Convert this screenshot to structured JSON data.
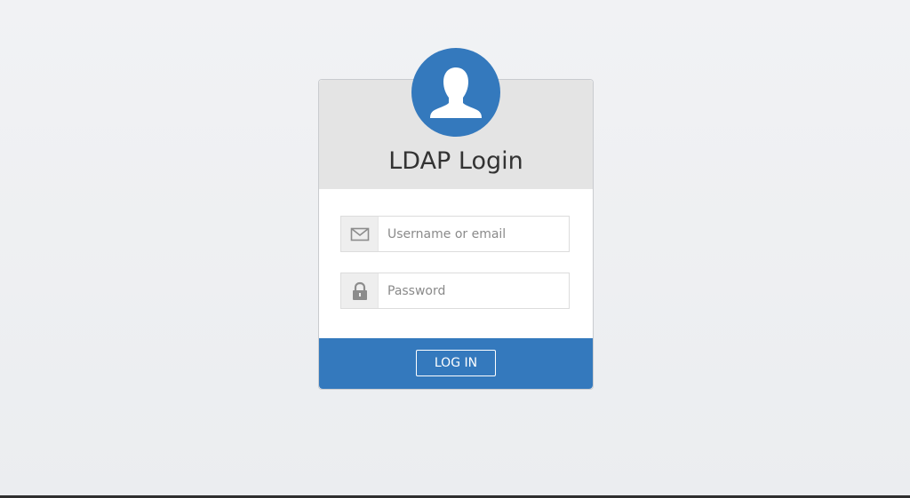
{
  "login_card": {
    "title": "LDAP Login",
    "avatar_icon": "user-silhouette-icon",
    "username": {
      "icon": "envelope-icon",
      "placeholder": "Username or email",
      "value": ""
    },
    "password": {
      "icon": "lock-icon",
      "placeholder": "Password",
      "value": ""
    },
    "submit_label": "LOG IN"
  },
  "colors": {
    "accent": "#3479bd",
    "header_bg": "#e4e4e4",
    "page_bg": "#eef0f2"
  }
}
